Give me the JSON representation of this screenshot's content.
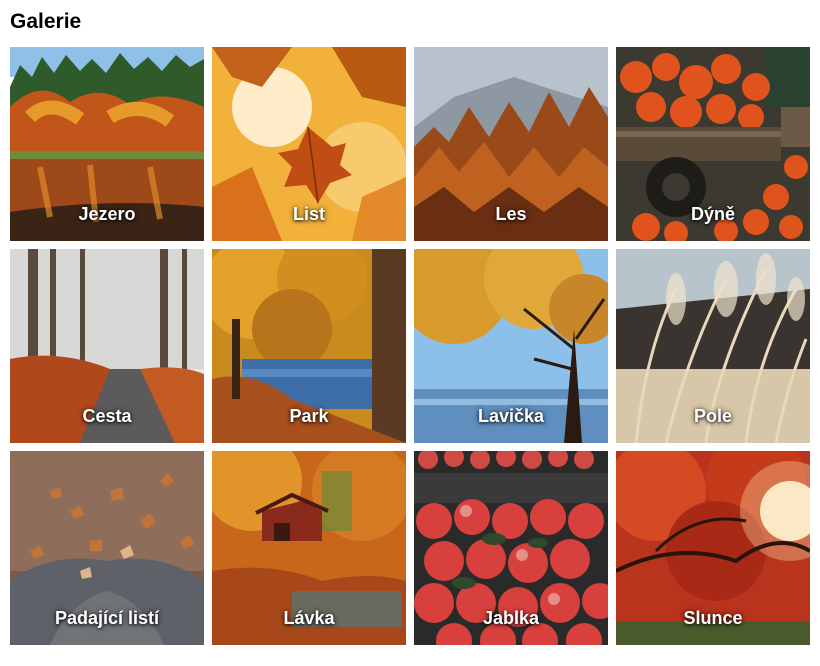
{
  "gallery": {
    "title": "Galerie",
    "items": [
      {
        "label": "Jezero",
        "image": "autumn-lake-forest"
      },
      {
        "label": "List",
        "image": "autumn-leaf-closeup"
      },
      {
        "label": "Les",
        "image": "autumn-mountain-forest"
      },
      {
        "label": "Dýně",
        "image": "pumpkins-on-cart"
      },
      {
        "label": "Cesta",
        "image": "foggy-forest-path"
      },
      {
        "label": "Park",
        "image": "park-tree-by-water"
      },
      {
        "label": "Lavička",
        "image": "tree-by-lake"
      },
      {
        "label": "Pole",
        "image": "pampas-grass-field"
      },
      {
        "label": "Padající listí",
        "image": "falling-leaves"
      },
      {
        "label": "Lávka",
        "image": "covered-bridge-forest"
      },
      {
        "label": "Jablka",
        "image": "crate-of-apples"
      },
      {
        "label": "Slunce",
        "image": "red-tree-sunlight"
      }
    ]
  }
}
